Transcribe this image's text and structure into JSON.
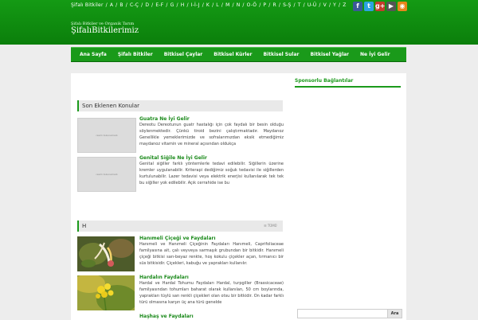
{
  "header": {
    "alpha_links": [
      "Şifalı Bitkiler",
      "/",
      "A",
      "/",
      "B",
      "/",
      "C-Ç",
      "/",
      "D",
      "/",
      "E-F",
      "/",
      "G",
      "/",
      "H",
      "/",
      "I-İ-J",
      "/",
      "K",
      "/",
      "L",
      "/",
      "M",
      "/",
      "N",
      "/",
      "O-Ö",
      "/",
      "P",
      "/",
      "R",
      "/",
      "S-Ş",
      "/",
      "T",
      "/",
      "U-Ü",
      "/",
      "V",
      "/",
      "Y",
      "/",
      "Z"
    ],
    "tagline": "Şifalı Bitkiler ve Organik Tarım",
    "logo": "ŞifalıBitkilerimiz",
    "social": [
      {
        "icon": "facebook-icon",
        "glyph": "f",
        "color": "#3b5998"
      },
      {
        "icon": "twitter-icon",
        "glyph": "t",
        "color": "#2ba3e1"
      },
      {
        "icon": "google-plus-icon",
        "glyph": "g+",
        "color": "#c43c2c"
      },
      {
        "icon": "youtube-icon",
        "glyph": "▶",
        "color": "#555555"
      },
      {
        "icon": "rss-icon",
        "glyph": "◉",
        "color": "#e8851c"
      }
    ]
  },
  "nav": [
    "Ana Sayfa",
    "Şifalı Bitkiler",
    "Bitkisel Çaylar",
    "Bitkisel Kürler",
    "Bitkisel Sular",
    "Bitkisel Yağlar",
    "Ne İyi Gelir"
  ],
  "recent": {
    "heading": "Son Eklenen Konular",
    "thumb_text": "resim bulunamadı",
    "items": [
      {
        "title": "Guatra Ne İyi Gelir",
        "text": "Dereotu Dereotunun guatr hastalığı için çok faydalı bir besin olduğu söylenmektedir. Çünkü tiroid bezini çalıştırmaktadır. Maydanoz Genellikle yemeklerimizde ve sofralarımızdan eksik etmediğimiz maydanoz vitamin ve mineral açısından oldukça"
      },
      {
        "title": "Genital Siğile Ne İyi Gelir",
        "text": "Genital siğiller farklı yöntemlerle tedavi edilebilir. Siğillerin üzerine kremler uygulanabilir. Kriterapi dediğimiz soğuk tedavisi ile siğillerden kurtulunabilir. Lazer tedavisi veya elektrik enerjisi kullanılarak tek tek bu siğiller yok edilebilir. Açık cerrahide ise bu"
      }
    ]
  },
  "section_h": {
    "heading": "H",
    "all_label": "TÜMÜ",
    "items": [
      {
        "title": "Hanımeli Çiçeği ve Faydaları",
        "text": "Hanımeli ve Hanımeli Çiçeğinin Faydaları Hanımeli, Caprifoliaceae familyasına ait, çalı veyveya sarmaşık grubundan bir bitkidir. Hanımeli çiçeği bitkisi sarı-beyaz renkte, hoş kokulu çiçekler açan, tırmanıcı bir süs bitkisidir. Çiçekleri, kabuğu ve yaprakları kullanılır."
      },
      {
        "title": "Hardalın Faydaları",
        "text": "Hardal ve Hardal Tohumu Faydaları Hardal, turpgiller (Brassicaceae) familyasından tohumları baharat olarak kullanılan, 50 cm boylarında, yaprakları tüylü sarı renkli çiçekleri olan otsu bir bitkidir. On kadar farklı türü olmasına karşın üç ana türü genelde"
      },
      {
        "title": "Haşhaş ve Faydaları",
        "text": ""
      }
    ]
  },
  "sidebar": {
    "title": "Sponsorlu Bağlantılar",
    "search_button": "Ara"
  }
}
